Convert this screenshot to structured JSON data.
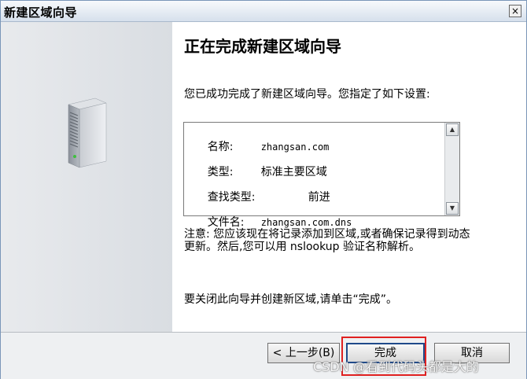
{
  "window": {
    "title": "新建区域向导",
    "close_label": "×"
  },
  "main": {
    "heading": "正在完成新建区域向导",
    "intro": "您已成功完成了新建区域向导。您指定了如下设置:",
    "summary": {
      "rows": [
        {
          "label": "名称:",
          "value": "zhangsan.com"
        },
        {
          "label": "类型:",
          "value": "标准主要区域"
        },
        {
          "label": "查找类型:",
          "value": "前进"
        },
        {
          "label": "文件名:",
          "value": "zhangsan.com.dns"
        }
      ],
      "scroll_up": "▲",
      "scroll_down": "▼"
    },
    "note": "注意: 您应该现在将记录添加到区域,或者确保记录得到动态更新。然后,您可以用 nslookup 验证名称解析。",
    "closing": "要关闭此向导并创建新区域,请单击“完成”。"
  },
  "footer": {
    "back_label": "< 上一步(B)",
    "finish_label": "完成",
    "cancel_label": "取消"
  },
  "watermark": "CSDN @看到代码头都是大的"
}
